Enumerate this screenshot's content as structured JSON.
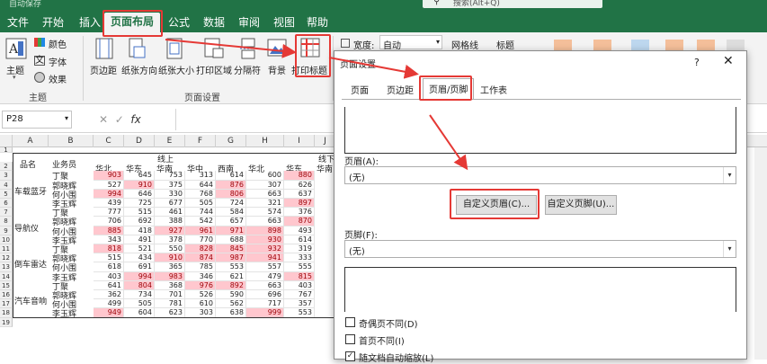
{
  "titlebar": {
    "autosave": "自动保存",
    "search_placeholder": "搜索(Alt+Q)"
  },
  "menu": {
    "tabs": [
      "文件",
      "开始",
      "插入",
      "页面布局",
      "公式",
      "数据",
      "审阅",
      "视图",
      "帮助"
    ],
    "active": "页面布局"
  },
  "ribbon": {
    "theme_group": {
      "theme": "主题",
      "colors": "颜色",
      "fonts": "字体",
      "effects": "效果",
      "group_label": "主题"
    },
    "page_setup": {
      "margins": "页边距",
      "orientation": "纸张方向",
      "size": "纸张大小",
      "print_area": "打印区域",
      "breaks": "分隔符",
      "background": "背景",
      "print_titles": "打印标题",
      "group_label": "页面设置"
    },
    "scale": {
      "width_label": "宽度:",
      "width_value": "自动"
    },
    "sheet_options": {
      "gridlines": "网格线",
      "headings": "标题"
    }
  },
  "formula_bar": {
    "namebox": "P28",
    "fx": "fx"
  },
  "sheet": {
    "columns": [
      "A",
      "B",
      "C",
      "D",
      "E",
      "F",
      "G",
      "H",
      "I",
      "J"
    ],
    "rows": [
      "1",
      "2",
      "3",
      "4",
      "5",
      "6",
      "7",
      "8",
      "9",
      "10",
      "11",
      "12",
      "13",
      "14",
      "15",
      "16",
      "17",
      "18",
      "19"
    ],
    "header": {
      "product": "品名",
      "salesperson": "业务员",
      "online": "线上",
      "online2": "线下"
    },
    "regions": [
      "华北",
      "华东",
      "华南",
      "华中",
      "西南",
      "华北",
      "华东",
      "华南"
    ],
    "products": [
      "车载蓝牙",
      "导航仪",
      "倒车雷达",
      "汽车音响"
    ],
    "people": [
      "丁聚",
      "郭晓辉",
      "何小围",
      "李玉辉"
    ],
    "data": [
      [
        903,
        645,
        753,
        313,
        614,
        600,
        880
      ],
      [
        527,
        910,
        375,
        644,
        876,
        307,
        626
      ],
      [
        994,
        646,
        330,
        768,
        806,
        663,
        637
      ],
      [
        439,
        725,
        677,
        505,
        724,
        321,
        897
      ],
      [
        777,
        515,
        461,
        744,
        584,
        574,
        376
      ],
      [
        706,
        692,
        388,
        542,
        657,
        663,
        870
      ],
      [
        885,
        418,
        927,
        961,
        971,
        898,
        493
      ],
      [
        343,
        491,
        378,
        770,
        688,
        930,
        614
      ],
      [
        818,
        521,
        550,
        828,
        845,
        932,
        319
      ],
      [
        515,
        434,
        910,
        874,
        987,
        941,
        333
      ],
      [
        618,
        691,
        365,
        785,
        553,
        557,
        555
      ],
      [
        403,
        994,
        983,
        346,
        621,
        479,
        815
      ],
      [
        641,
        804,
        368,
        976,
        892,
        663,
        403
      ],
      [
        362,
        734,
        701,
        526,
        590,
        696,
        767
      ],
      [
        499,
        505,
        781,
        610,
        562,
        717,
        357
      ],
      [
        949,
        604,
        623,
        303,
        638,
        999,
        553
      ]
    ]
  },
  "dialog": {
    "title": "页面设置",
    "help": "?",
    "close": "✕",
    "tabs": [
      "页面",
      "页边距",
      "页眉/页脚",
      "工作表"
    ],
    "active_tab": "页眉/页脚",
    "header_label": "页眉(A):",
    "header_value": "(无)",
    "custom_header": "自定义页眉(C)...",
    "custom_footer": "自定义页脚(U)...",
    "footer_label": "页脚(F):",
    "footer_value": "(无)",
    "options": [
      {
        "label": "奇偶页不同(D)",
        "checked": false
      },
      {
        "label": "首页不同(I)",
        "checked": false
      },
      {
        "label": "随文档自动缩放(L)",
        "checked": true
      }
    ]
  },
  "colors": {
    "excel_green": "#217346",
    "highlight_red": "#e53935",
    "cell_pink": "#ffc7ce"
  }
}
